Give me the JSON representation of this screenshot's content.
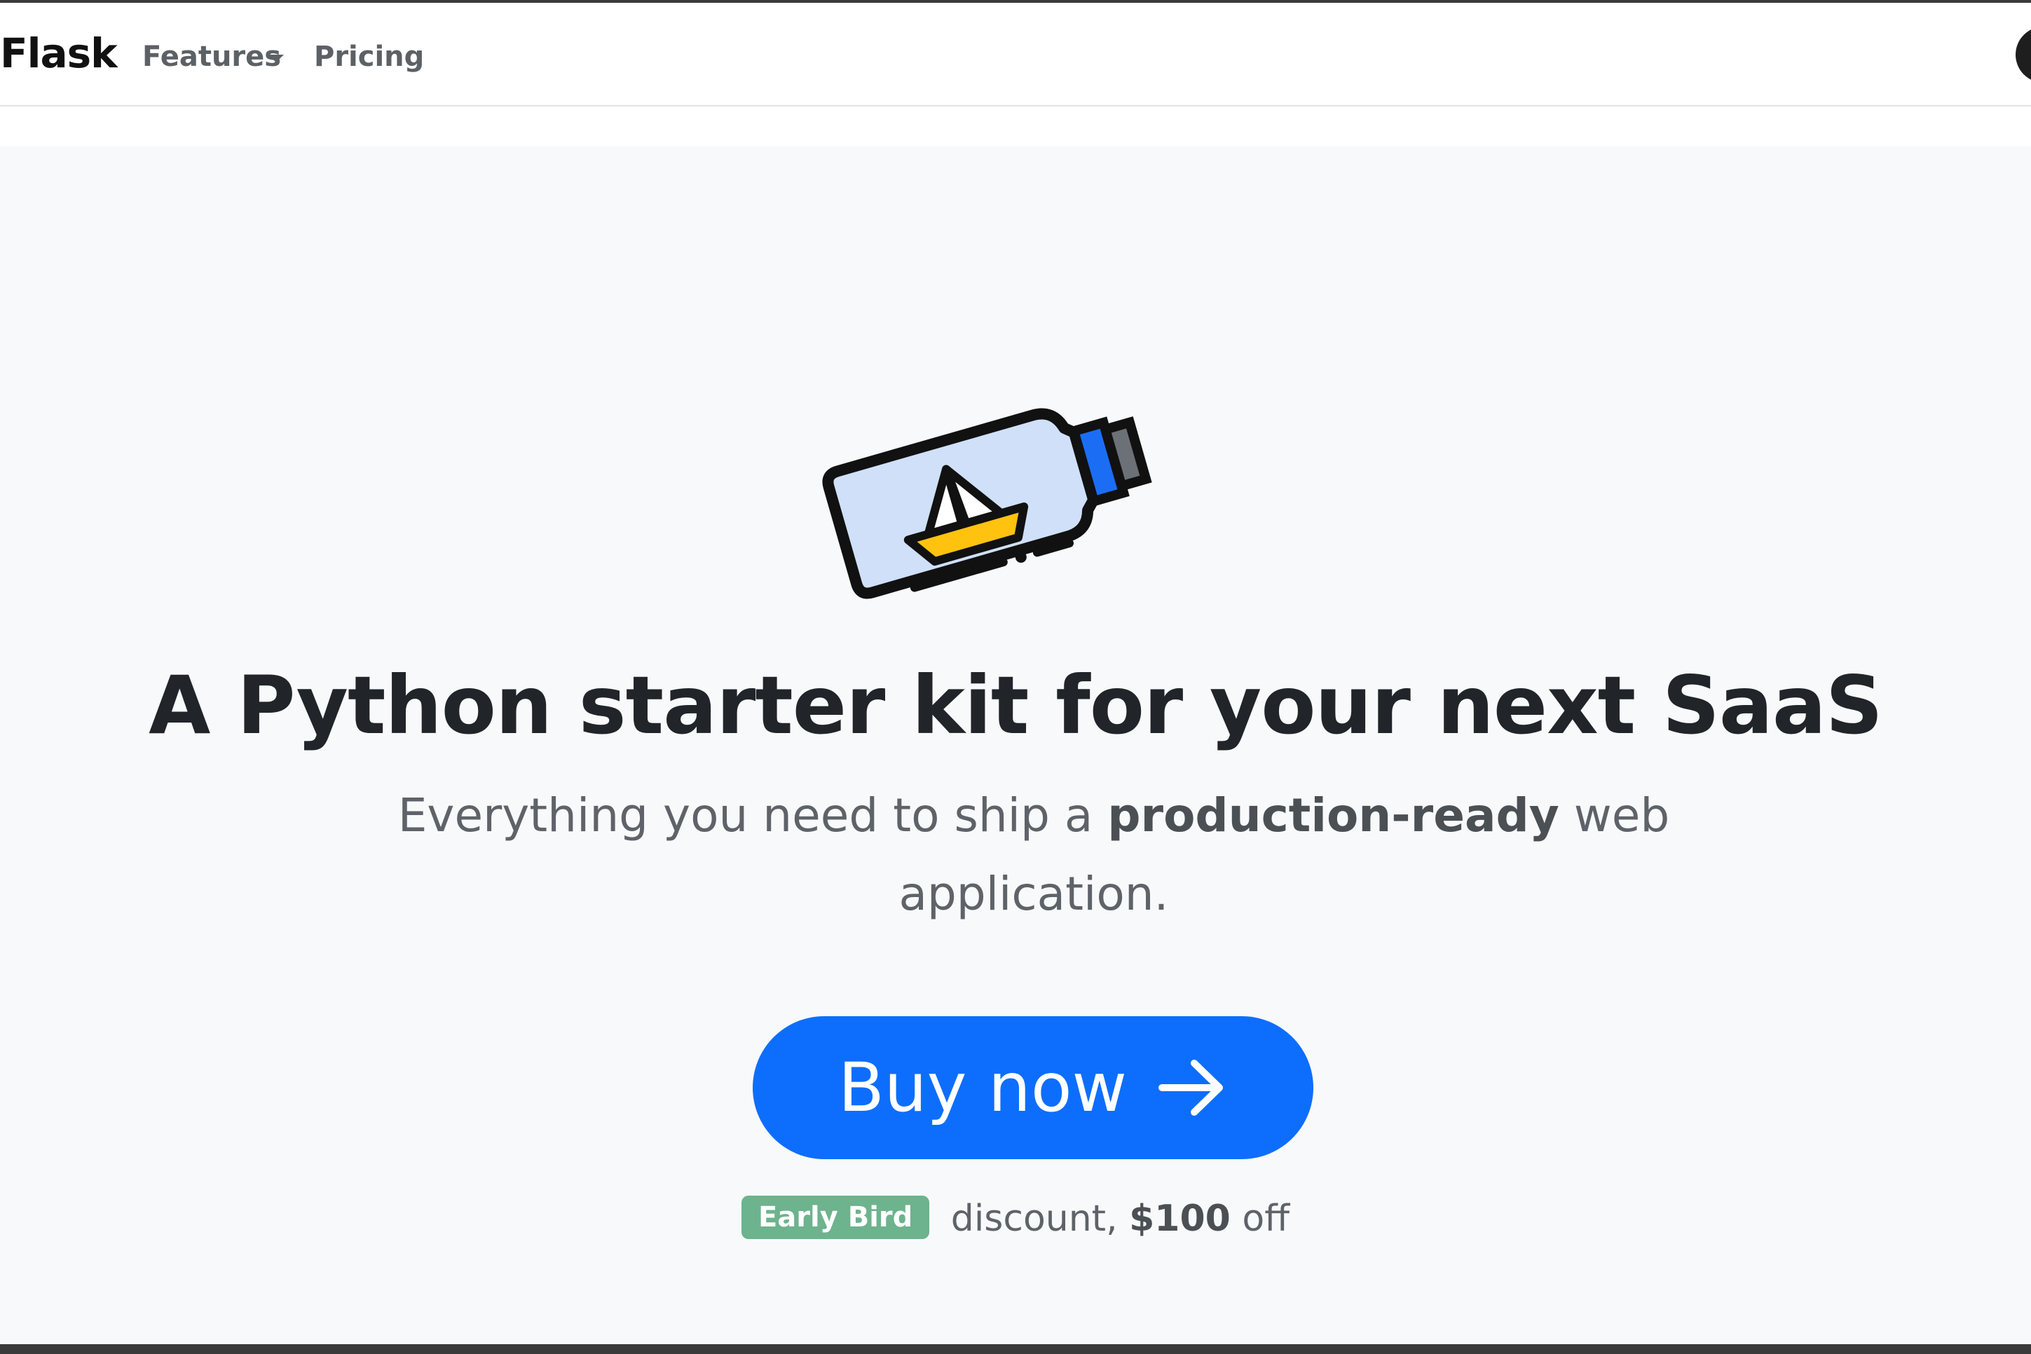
{
  "navbar": {
    "brand": "Flask",
    "links": [
      {
        "label": "Features",
        "has_dropdown": true
      },
      {
        "label": "Pricing",
        "has_dropdown": false
      }
    ],
    "avatar_icon": "user-avatar"
  },
  "hero": {
    "illustration_icon": "ship-in-bottle",
    "headline": "A Python starter kit for your next SaaS",
    "subtitle": {
      "before": "Everything you need to ship a ",
      "bold": "production-ready",
      "after": " web application."
    },
    "cta": {
      "label": "Buy now",
      "icon": "arrow-right-icon",
      "color": "#0d6efd"
    },
    "discount": {
      "badge": "Early Bird",
      "badge_color": "#6db38d",
      "middle": " discount, ",
      "amount": "$100",
      "after": " off"
    }
  }
}
